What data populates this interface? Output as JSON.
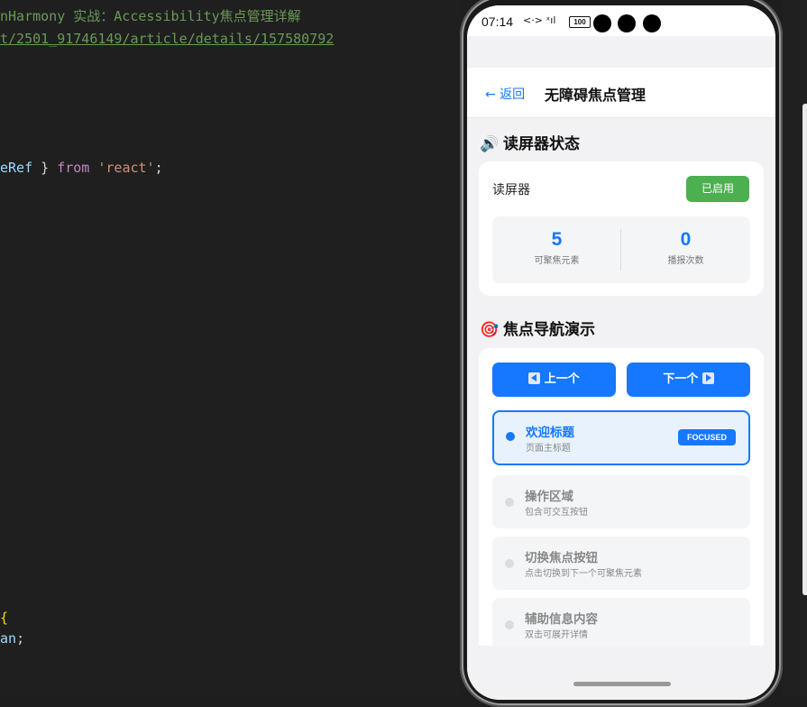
{
  "editor": {
    "line1": "nHarmony 实战：Accessibility焦点管理详解",
    "line2": "t/2501_91746149/article/details/157580792",
    "line3_var": "eRef",
    "line3_rest1": " } ",
    "line3_kw": "from",
    "line3_sp": " ",
    "line3_str": "'react'",
    "line3_end": ";",
    "line4": "{",
    "line5_var": "an",
    "line5_end": ";"
  },
  "status_bar": {
    "time": "07:14",
    "icons": "<·> ˣıl",
    "battery": "100"
  },
  "nav": {
    "back_label": "← 返回",
    "title": "无障碍焦点管理"
  },
  "screen_reader": {
    "section_icon": "🔊",
    "section_title": "读屏器状态",
    "label": "读屏器",
    "status_badge": "已启用",
    "stats": [
      {
        "value": "5",
        "label": "可聚焦元素"
      },
      {
        "value": "0",
        "label": "播报次数"
      }
    ]
  },
  "focus_demo": {
    "section_icon": "🎯",
    "section_title": "焦点导航演示",
    "prev_label": "上一个",
    "next_label": "下一个",
    "items": [
      {
        "title": "欢迎标题",
        "subtitle": "页面主标题",
        "badge": "FOCUSED"
      },
      {
        "title": "操作区域",
        "subtitle": "包含可交互按钮"
      },
      {
        "title": "切换焦点按钮",
        "subtitle": "点击切换到下一个可聚焦元素"
      },
      {
        "title": "辅助信息内容",
        "subtitle": "双击可展开详情"
      }
    ]
  },
  "colors": {
    "accent": "#1677ff",
    "success": "#4caf50",
    "background": "#f2f2f4"
  }
}
